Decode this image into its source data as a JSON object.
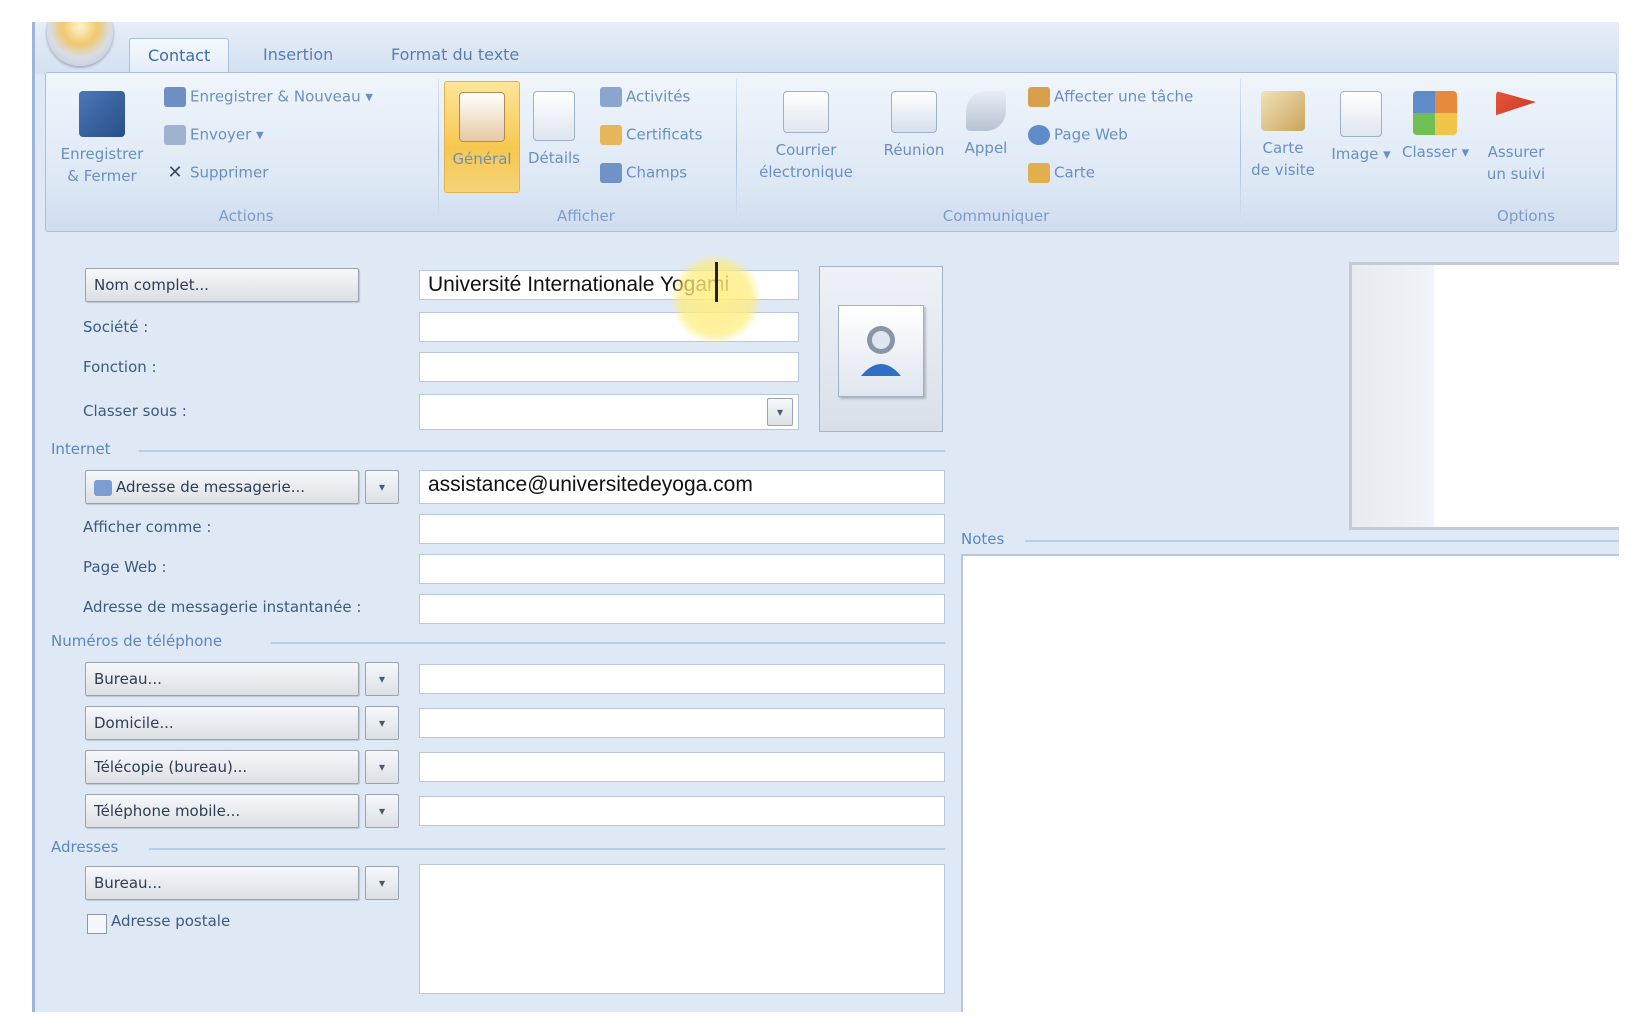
{
  "ribbon": {
    "tabs": [
      "Contact",
      "Insertion",
      "Format du texte"
    ],
    "groups": {
      "actions": {
        "label": "Actions",
        "save_close": "Enregistrer\n& Fermer",
        "save_new": "Enregistrer & Nouveau",
        "send": "Envoyer",
        "delete": "Supprimer"
      },
      "afficher": {
        "label": "Afficher",
        "general": "Général",
        "details": "Détails",
        "activities": "Activités",
        "certificates": "Certificats",
        "fields": "Champs"
      },
      "communiquer": {
        "label": "Communiquer",
        "email": "Courrier\nélectronique",
        "meeting": "Réunion",
        "call": "Appel",
        "assign_task": "Affecter une tâche",
        "web_page": "Page Web",
        "map": "Carte"
      },
      "options": {
        "label": "Options",
        "business_card": "Carte\nde visite",
        "image": "Image",
        "categorize": "Classer",
        "follow_up": "Assurer\nun suivi"
      }
    }
  },
  "form": {
    "full_name_button": "Nom complet...",
    "full_name_value": "Université Internationale Yogami",
    "company_label": "Société :",
    "job_title_label": "Fonction :",
    "file_as_label": "Classer sous :",
    "internet_section": "Internet",
    "email_button": "Adresse de messagerie...",
    "email_value": "assistance@universitedeyoga.com",
    "display_as_label": "Afficher comme :",
    "web_page_label": "Page Web :",
    "im_label": "Adresse de messagerie instantanée :",
    "phone_section": "Numéros de téléphone",
    "phone_buttons": [
      "Bureau...",
      "Domicile...",
      "Télécopie (bureau)...",
      "Téléphone mobile..."
    ],
    "address_section": "Adresses",
    "address_button": "Bureau...",
    "postal_checkbox": "Adresse postale",
    "notes_label": "Notes"
  }
}
